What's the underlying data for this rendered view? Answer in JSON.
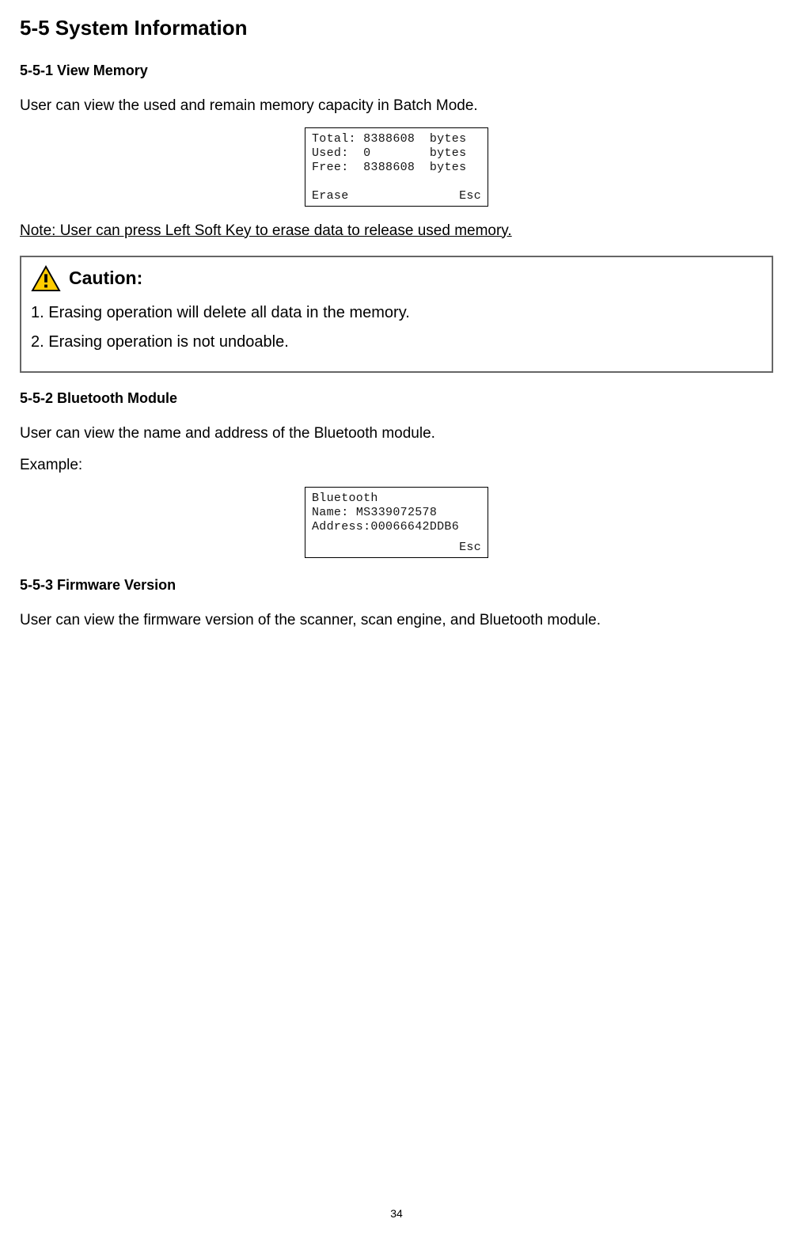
{
  "heading_main": "5-5 System Information",
  "section1": {
    "heading": "5-5-1 View Memory",
    "intro": "User can view the used and remain memory capacity in Batch Mode.",
    "lcd": {
      "total_label": "Total:",
      "total_value": "8388608",
      "total_unit": "bytes",
      "used_label": "Used:",
      "used_value": "0",
      "used_unit": "bytes",
      "free_label": "Free:",
      "free_value": "8388608",
      "free_unit": "bytes",
      "softkey_left": "Erase",
      "softkey_right": "Esc"
    },
    "note": "Note: User can press Left Soft Key to erase data to release used memory."
  },
  "caution": {
    "title": "Caution:",
    "items": [
      "1. Erasing operation will delete all data in the memory.",
      "2. Erasing operation is not undoable."
    ]
  },
  "section2": {
    "heading": "5-5-2 Bluetooth Module",
    "intro": "User can view the name and address of the Bluetooth module.",
    "example_label": "Example:",
    "lcd": {
      "line1": "Bluetooth",
      "name_label": "Name:",
      "name_value": "MS339072578",
      "addr_label": "Address:",
      "addr_value": "00066642DDB6",
      "softkey_right": "Esc"
    }
  },
  "section3": {
    "heading": "5-5-3 Firmware Version",
    "intro": "User can view the firmware version of the scanner, scan engine, and Bluetooth module."
  },
  "page_number": "34"
}
